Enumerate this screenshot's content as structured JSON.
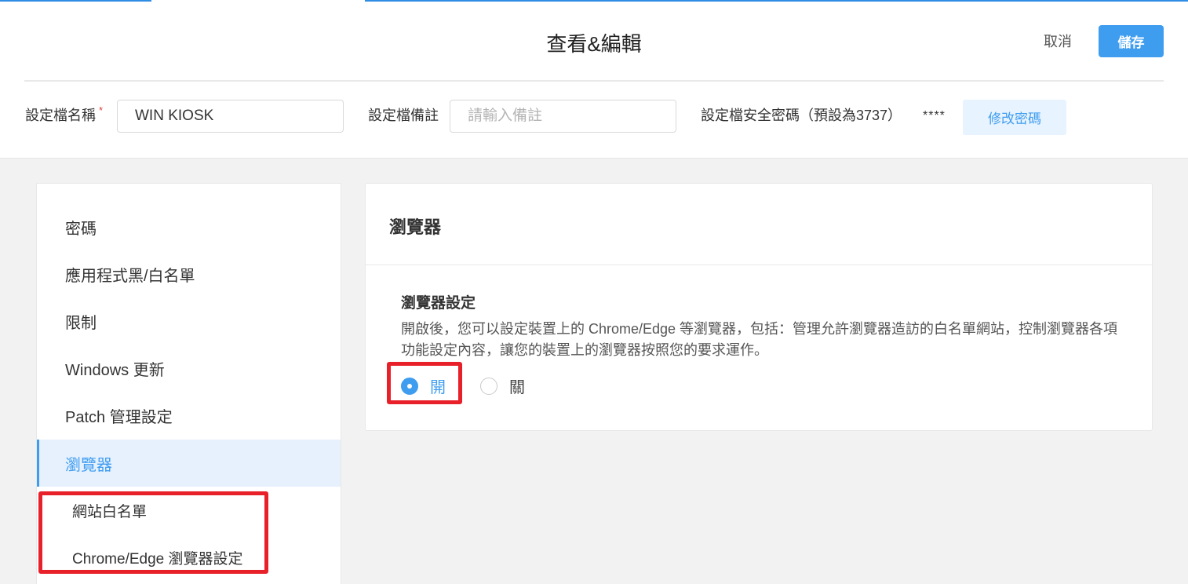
{
  "header": {
    "title": "查看&編輯",
    "cancel_label": "取消",
    "save_label": "儲存"
  },
  "profile": {
    "name_label": "設定檔名稱",
    "name_required": "*",
    "name_value": "WIN KIOSK",
    "note_label": "設定檔備註",
    "note_placeholder": "請輸入備註",
    "password_label": "設定檔安全密碼（預設為3737）",
    "password_mask": "****",
    "change_password_label": "修改密碼"
  },
  "sidebar": {
    "items": [
      {
        "label": "密碼"
      },
      {
        "label": "應用程式黑/白名單"
      },
      {
        "label": "限制"
      },
      {
        "label": "Windows 更新"
      },
      {
        "label": "Patch 管理設定"
      },
      {
        "label": "瀏覽器",
        "active": true
      }
    ],
    "sub_items": [
      {
        "label": "網站白名單"
      },
      {
        "label": "Chrome/Edge 瀏覽器設定"
      }
    ]
  },
  "main": {
    "title": "瀏覽器",
    "section_title": "瀏覽器設定",
    "description": "開啟後，您可以設定裝置上的 Chrome/Edge 等瀏覽器，包括：管理允許瀏覽器造訪的白名單網站，控制瀏覽器各項功能設定內容，讓您的裝置上的瀏覽器按照您的要求運作。",
    "radio_on_label": "開",
    "radio_off_label": "關",
    "selected": "on"
  },
  "colors": {
    "accent": "#3f9df0",
    "highlight_box": "#e8202a",
    "active_bg": "#e7f1fd"
  }
}
